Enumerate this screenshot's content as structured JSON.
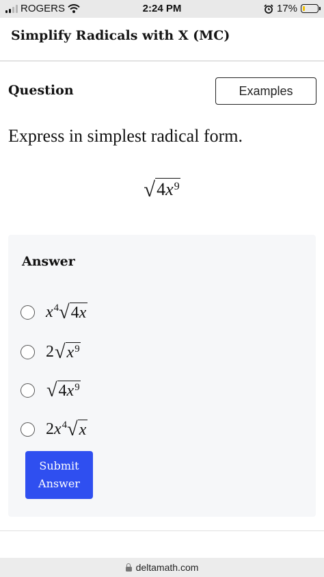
{
  "status_bar": {
    "carrier": "ROGERS",
    "time": "2:24 PM",
    "battery": "17%",
    "battery_level": 0.17,
    "icons": [
      "signal-icon",
      "wifi-icon",
      "alarm-icon",
      "battery-icon"
    ]
  },
  "header": {
    "title": "Simplify Radicals with X (MC)"
  },
  "question": {
    "heading": "Question",
    "examples_label": "Examples",
    "prompt": "Express in simplest radical form.",
    "expression": {
      "coef": "4",
      "var": "x",
      "exp": "9"
    }
  },
  "answer": {
    "heading": "Answer",
    "choices": [
      {
        "outer_coef": "",
        "outer_var": "x",
        "outer_exp": "4",
        "rad_coef": "4",
        "rad_var": "x",
        "rad_exp": ""
      },
      {
        "outer_coef": "2",
        "outer_var": "",
        "outer_exp": "",
        "rad_coef": "",
        "rad_var": "x",
        "rad_exp": "9"
      },
      {
        "outer_coef": "",
        "outer_var": "",
        "outer_exp": "",
        "rad_coef": "4",
        "rad_var": "x",
        "rad_exp": "9"
      },
      {
        "outer_coef": "2",
        "outer_var": "x",
        "outer_exp": "4",
        "rad_coef": "",
        "rad_var": "x",
        "rad_exp": ""
      }
    ],
    "submit_line1": "Submit",
    "submit_line2": "Answer"
  },
  "url_bar": {
    "domain": "deltamath.com"
  },
  "colors": {
    "accent": "#2f4ff0",
    "battery": "#f2c100",
    "card_bg": "#f6f7f9"
  }
}
